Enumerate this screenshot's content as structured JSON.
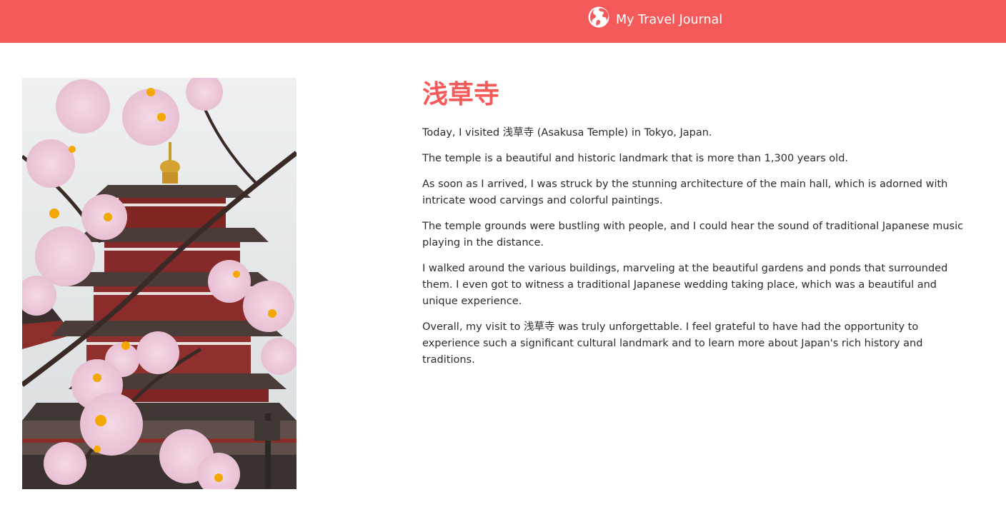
{
  "header": {
    "title": "My Travel Journal",
    "icon": "globe-icon",
    "background_color": "#f55a5a",
    "text_color": "#ffffff"
  },
  "entry": {
    "photo": {
      "subject": "pagoda-with-cherry-blossoms",
      "alt": "浅草寺"
    },
    "title": "浅草寺",
    "title_color": "#f55a5a",
    "paragraphs": [
      "Today, I visited 浅草寺 (Asakusa Temple) in Tokyo, Japan.",
      "The temple is a beautiful and historic landmark that is more than 1,300 years old.",
      "As soon as I arrived, I was struck by the stunning architecture of the main hall, which is adorned with intricate wood carvings and colorful paintings.",
      "The temple grounds were bustling with people, and I could hear the sound of traditional Japanese music playing in the distance.",
      "I walked around the various buildings, marveling at the beautiful gardens and ponds that surrounded them. I even got to witness a traditional Japanese wedding taking place, which was a beautiful and unique experience.",
      "Overall, my visit to 浅草寺 was truly unforgettable. I feel grateful to have had the opportunity to experience such a significant cultural landmark and to learn more about Japan's rich history and traditions."
    ]
  }
}
